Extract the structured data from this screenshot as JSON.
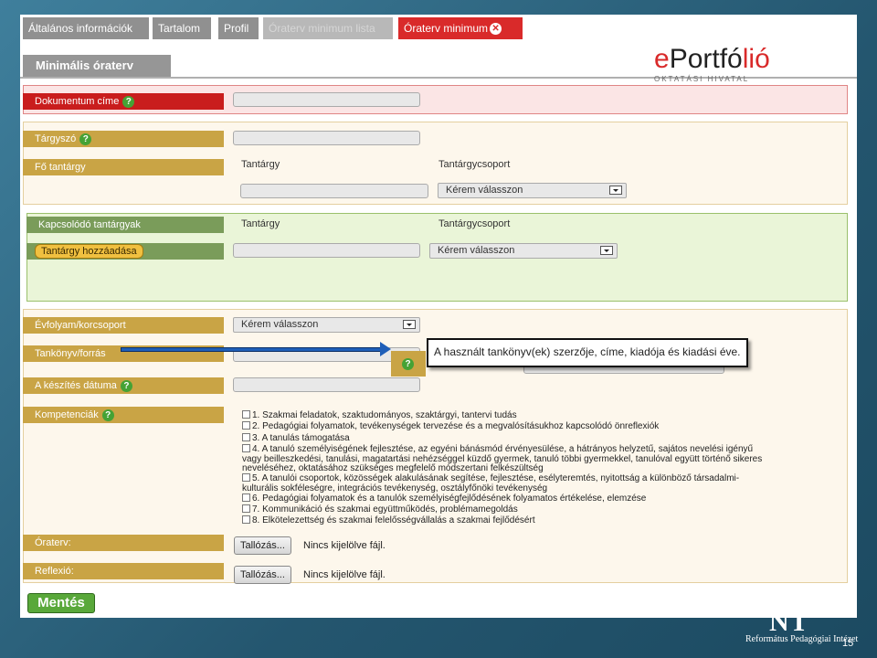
{
  "tabs": [
    {
      "label": "Általános információk"
    },
    {
      "label": "Tartalom"
    },
    {
      "label": "Profil"
    },
    {
      "label": "Óraterv minimum lista"
    },
    {
      "label": "Óraterv minimum"
    }
  ],
  "header": {
    "title": "Minimális óraterv"
  },
  "logo": {
    "main_e": "e",
    "main_p": "Portfó",
    "main_end": "lió",
    "sub": "OKTATÁSI HIVATAL"
  },
  "fields": {
    "doc_title": "Dokumentum címe",
    "subject_term": "Tárgyszó",
    "main_subject": "Fő tantárgy",
    "related_subjects": "Kapcsolódó tantárgyak",
    "grade": "Évfolyam/korcsoport",
    "textbook": "Tankönyv/forrás",
    "date": "A készítés dátuma",
    "competencies": "Kompetenciák",
    "lesson_plan": "Óraterv:",
    "reflection": "Reflexió:"
  },
  "columns": {
    "subject": "Tantárgy",
    "subject_group": "Tantárgycsoport"
  },
  "select_placeholder": "Kérem válasszon",
  "add_subject_button": "Tantárgy hozzáadása",
  "tooltip": "A használt tankönyv(ek) szerzője, címe, kiadója és kiadási éve.",
  "help_symbol": "?",
  "competencies": [
    "1. Szakmai feladatok, szaktudományos, szaktárgyi, tantervi tudás",
    "2. Pedagógiai folyamatok, tevékenységek tervezése és a megvalósításukhoz kapcsolódó önreflexiók",
    "3. A tanulás támogatása",
    "4. A tanuló személyiségének fejlesztése, az egyéni bánásmód érvényesülése, a hátrányos helyzetű, sajátos nevelési igényű",
    "vagy beilleszkedési, tanulási, magatartási nehézséggel küzdő gyermek, tanuló többi gyermekkel, tanulóval együtt történő sikeres",
    "neveléséhez, oktatásához szükséges megfelelő módszertani felkészültség",
    "5. A tanulói csoportok, közösségek alakulásának segítése, fejlesztése, esélyteremtés, nyitottság a különböző társadalmi-",
    "kulturális sokféleségre, integrációs tevékenység, osztályfőnöki tevékenység",
    "6. Pedagógiai folyamatok és a tanulók személyiségfejlődésének folyamatos értékelése, elemzése",
    "7. Kommunikáció és szakmai együttműködés, problémamegoldás",
    "8. Elkötelezettség és szakmai felelősségvállalás a szakmai fejlődésért"
  ],
  "browse_button": "Tallózás...",
  "no_file": "Nincs kijelölve fájl.",
  "save_button": "Mentés",
  "footer": {
    "brand_big": "NT",
    "brand_text": "Református Pedagógiai Intézet",
    "page_number": "15"
  }
}
